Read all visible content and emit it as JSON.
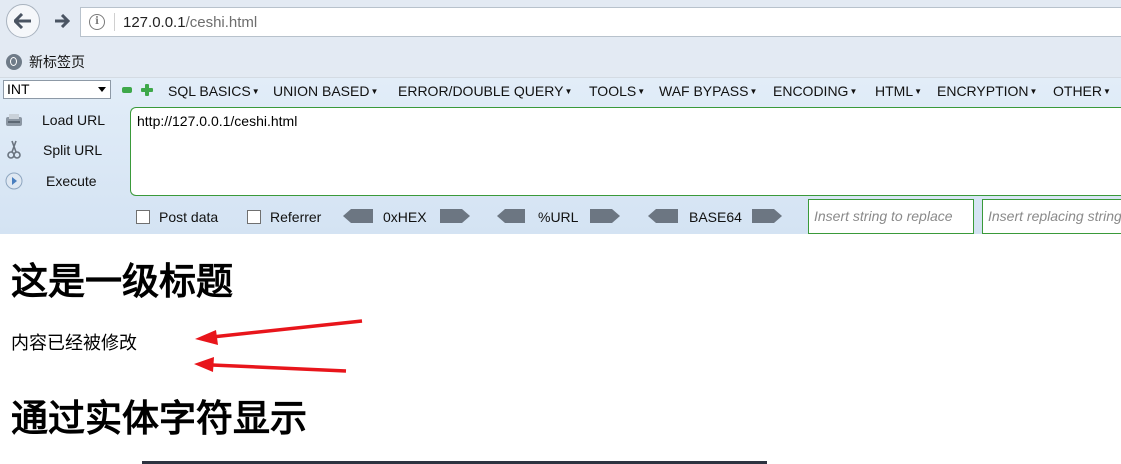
{
  "browser": {
    "url_host": "127.0.0.1",
    "url_path": "/ceshi.html"
  },
  "bookmarks": {
    "new_tab_label": "新标签页"
  },
  "hackbar": {
    "select_value": "INT",
    "menus": [
      "SQL BASICS",
      "UNION BASED",
      "ERROR/DOUBLE QUERY",
      "TOOLS",
      "WAF BYPASS",
      "ENCODING",
      "HTML",
      "ENCRYPTION",
      "OTHER"
    ],
    "load_url": "Load URL",
    "split_url": "Split URL",
    "execute": "Execute",
    "url_value": "http://127.0.0.1/ceshi.html",
    "post_data": "Post data",
    "referrer": "Referrer",
    "hex": "0xHEX",
    "url_enc": "%URL",
    "base64": "BASE64",
    "replace_placeholder": "Insert string to replace",
    "replacing_placeholder": "Insert replacing string"
  },
  "page": {
    "heading1": "这是一级标题",
    "paragraph": "内容已经被修改",
    "heading2": "通过实体字符显示"
  },
  "colors": {
    "arrow": "#e8151b",
    "green_border": "#3a9a3a"
  }
}
